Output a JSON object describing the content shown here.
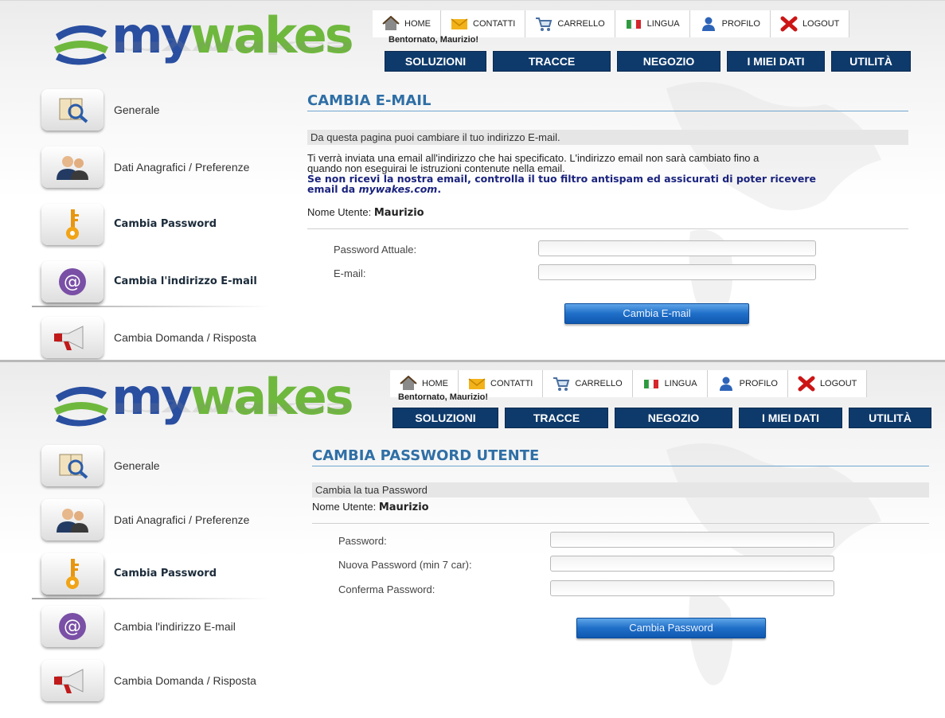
{
  "brand": {
    "logo_my": "my",
    "logo_wakes": "wakes"
  },
  "top_menu": [
    {
      "label": "HOME",
      "icon": "home-icon"
    },
    {
      "label": "CONTATTI",
      "icon": "envelope-icon"
    },
    {
      "label": "CARRELLO",
      "icon": "cart-icon"
    },
    {
      "label": "LINGUA",
      "icon": "italian-flag-icon"
    },
    {
      "label": "PROFILO",
      "icon": "user-icon"
    },
    {
      "label": "LOGOUT",
      "icon": "logout-x-icon"
    }
  ],
  "welcome": "Bentornato, Maurizio!",
  "main_nav": [
    "SOLUZIONI",
    "TRACCE",
    "NEGOZIO",
    "I MIEI DATI",
    "UTILITÀ"
  ],
  "sidebar": [
    {
      "label": "Generale",
      "icon": "magnifier-book-icon"
    },
    {
      "label": "Dati Anagrafici / Preferenze",
      "icon": "users-icon"
    },
    {
      "label": "Cambia Password",
      "icon": "key-icon"
    },
    {
      "label": "Cambia l'indirizzo E-mail",
      "icon": "at-sign-icon"
    },
    {
      "label": "Cambia Domanda / Risposta",
      "icon": "megaphone-icon"
    }
  ],
  "email_page": {
    "title": "CAMBIA E-MAIL",
    "intro": "Da questa pagina puoi cambiare il tuo indirizzo E-mail.",
    "info_line1": "Ti verrà inviata una email all'indirizzo che hai specificato. L'indirizzo email non sarà cambiato fino a",
    "info_line2": "quando non eseguirai le istruzioni contenute nella email.",
    "warn_line1": "Se non ricevi la nostra email, controlla il tuo filtro antispam ed assicurati di poter ricevere",
    "warn_line2_prefix": "email da ",
    "warn_domain": "mywakes.com",
    "warn_suffix": ".",
    "username_label": "Nome Utente:",
    "username": "Maurizio",
    "fields": [
      {
        "label": "Password Attuale:",
        "value": ""
      },
      {
        "label": "E-mail:",
        "value": ""
      }
    ],
    "submit": "Cambia E-mail"
  },
  "password_page": {
    "title": "CAMBIA PASSWORD UTENTE",
    "intro": "Cambia la tua Password",
    "username_label": "Nome Utente:",
    "username": "Maurizio",
    "fields": [
      {
        "label": "Password:",
        "value": ""
      },
      {
        "label": "Nuova Password (min 7 car):",
        "value": ""
      },
      {
        "label": "Conferma Password:",
        "value": ""
      }
    ],
    "submit": "Cambia Password"
  }
}
